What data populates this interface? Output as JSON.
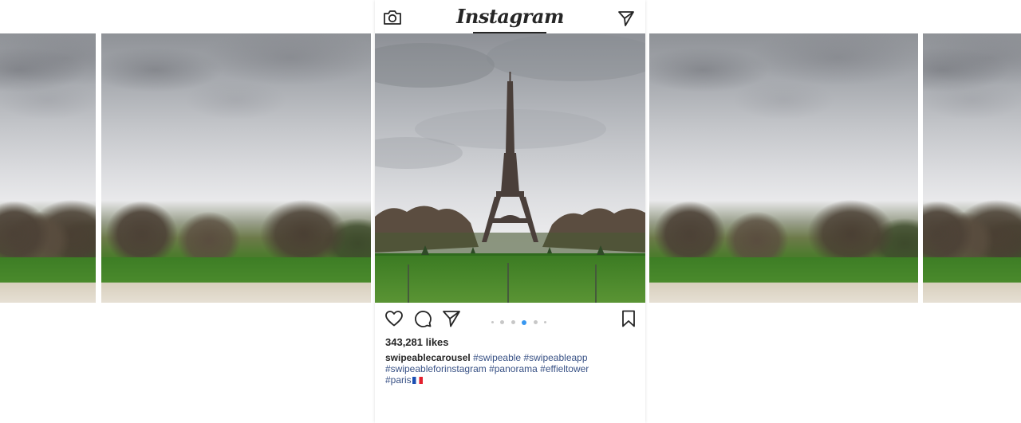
{
  "app": {
    "logo_text": "Instagram",
    "icons": {
      "camera": "camera-icon",
      "direct": "send-icon",
      "like": "heart-icon",
      "comment": "comment-icon",
      "share": "send-icon",
      "save": "bookmark-icon"
    }
  },
  "post": {
    "likes": "343,281 likes",
    "username": "swipeablecarousel",
    "hashtags_line1": [
      "#swipeable",
      "#swipeableapp"
    ],
    "hashtags_line2": [
      "#swipeableforinstagram",
      "#panorama",
      "#effieltower"
    ],
    "hashtags_line3": [
      "#paris"
    ],
    "flag_emoji": "🇫🇷"
  },
  "carousel": {
    "slide_count": 5,
    "active_index": 3
  },
  "colors": {
    "text": "#262626",
    "hashtag": "#385185",
    "active_dot": "#3897f0",
    "inactive_dot": "#c7c7c7"
  }
}
